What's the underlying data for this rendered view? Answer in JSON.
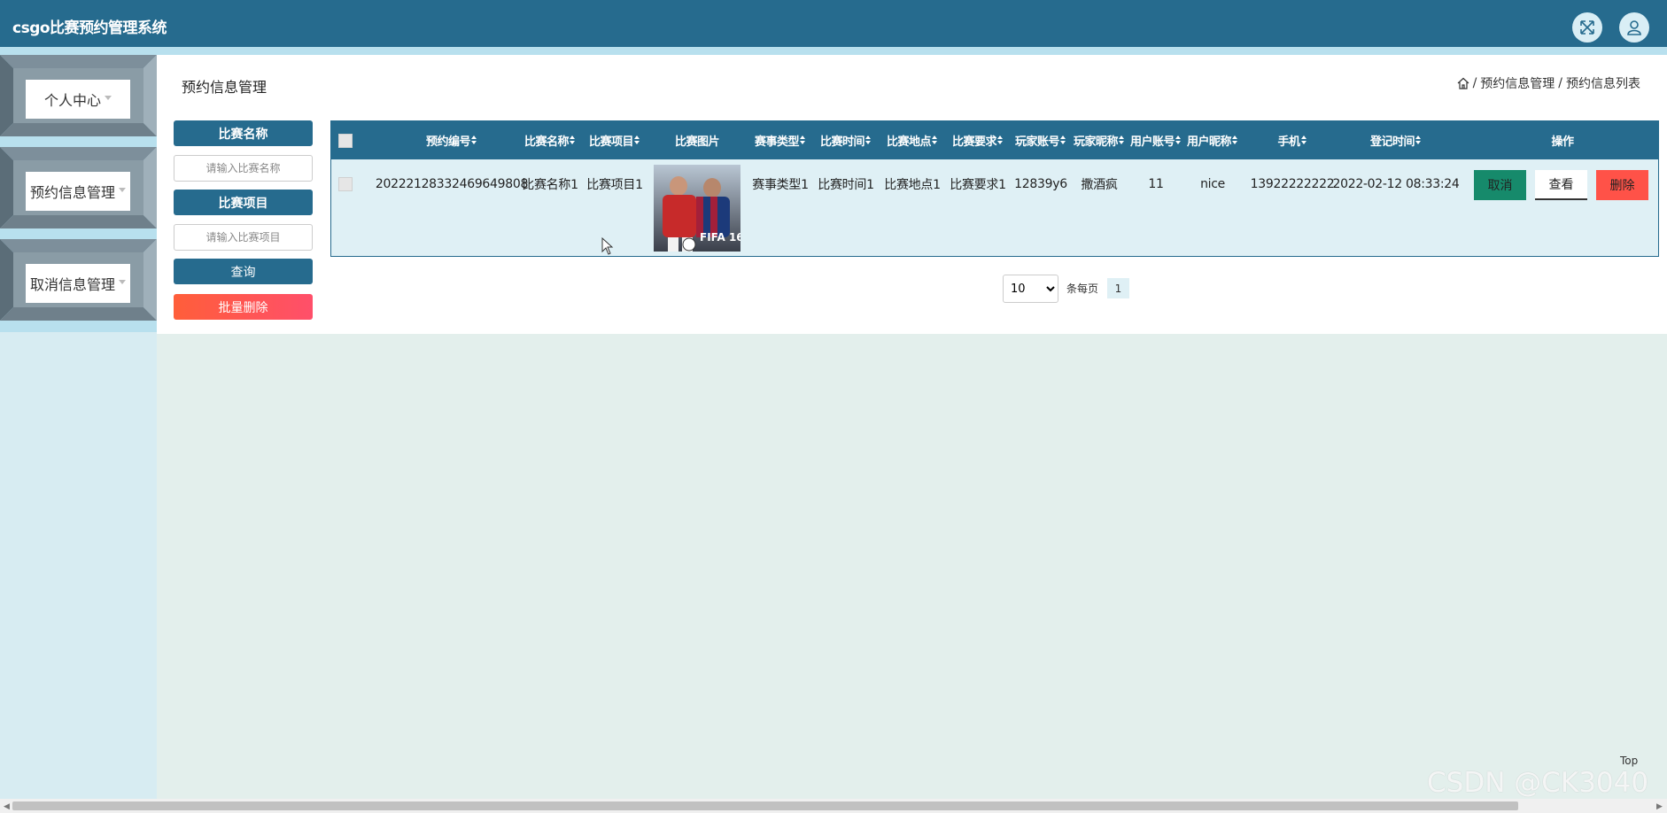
{
  "app": {
    "title": "csgo比赛预约管理系统"
  },
  "header": {
    "fullscreen_icon": "expand-icon",
    "user_icon": "user-icon"
  },
  "sidebar": {
    "items": [
      {
        "label": "个人中心"
      },
      {
        "label": "预约信息管理"
      },
      {
        "label": "取消信息管理"
      }
    ]
  },
  "page": {
    "title": "预约信息管理",
    "breadcrumb": [
      "预约信息管理",
      "预约信息列表"
    ]
  },
  "search": {
    "name_label": "比赛名称",
    "name_placeholder": "请输入比赛名称",
    "project_label": "比赛项目",
    "project_placeholder": "请输入比赛项目",
    "query_label": "查询",
    "batch_delete_label": "批量删除"
  },
  "table": {
    "headers": [
      "预约编号",
      "比赛名称",
      "比赛项目",
      "比赛图片",
      "赛事类型",
      "比赛时间",
      "比赛地点",
      "比赛要求",
      "玩家账号",
      "玩家昵称",
      "用户账号",
      "用户昵称",
      "手机",
      "登记时间",
      "操作"
    ],
    "rows": [
      {
        "id": "20222128332469649808",
        "name": "比赛名称1",
        "project": "比赛项目1",
        "image_alt": "FIFA 16",
        "type": "赛事类型1",
        "time": "比赛时间1",
        "location": "比赛地点1",
        "requirement": "比赛要求1",
        "player_account": "12839y6",
        "player_nick": "撒酒疯",
        "user_account": "11",
        "user_nick": "nice",
        "phone": "13922222222",
        "reg_time": "2022-02-12 08:33:24"
      }
    ],
    "actions": {
      "cancel": "取消",
      "view": "查看",
      "delete": "删除"
    }
  },
  "pagination": {
    "page_size": "10",
    "per_page_text": "条每页",
    "current_page": "1"
  },
  "footer": {
    "top_label": "Top",
    "watermark": "CSDN @CK3040"
  },
  "colors": {
    "primary": "#266b8e",
    "danger": "#ff5248",
    "success": "#168a6b",
    "sidebar": "#b8e0ee"
  }
}
